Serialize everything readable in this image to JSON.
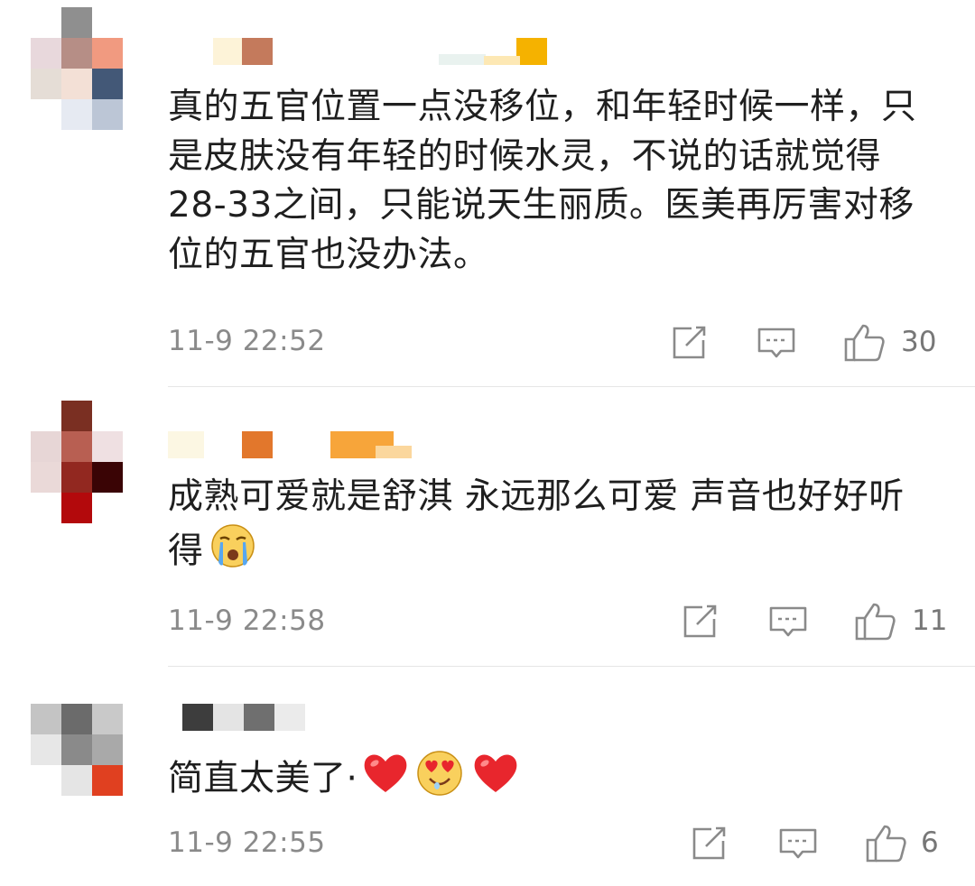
{
  "comments": [
    {
      "text": "真的五官位置一点没移位，和年轻时候一样，只是皮肤没有年轻的时候水灵，不说的话就觉得28-33之间，只能说天生丽质。医美再厉害对移位的五官也没办法。",
      "time": "11-9 22:52",
      "likes": "30"
    },
    {
      "text": "成熟可爱就是舒淇 永远那么可爱 声音也好好听得",
      "emoji": "crying-face-emoji",
      "time": "11-9 22:58",
      "likes": "11"
    },
    {
      "text": "简直太美了·",
      "emojis": [
        "red-heart-emoji",
        "heart-eyes-emoji",
        "red-heart-emoji"
      ],
      "time": "11-9 22:55",
      "likes": "6"
    }
  ],
  "icons": {
    "share": "share-icon",
    "reply": "comment-icon",
    "like": "thumbs-up-icon"
  },
  "colors": {
    "text": "#1f1f1f",
    "meta": "#8a8a8a",
    "heart": "#e8262d"
  }
}
